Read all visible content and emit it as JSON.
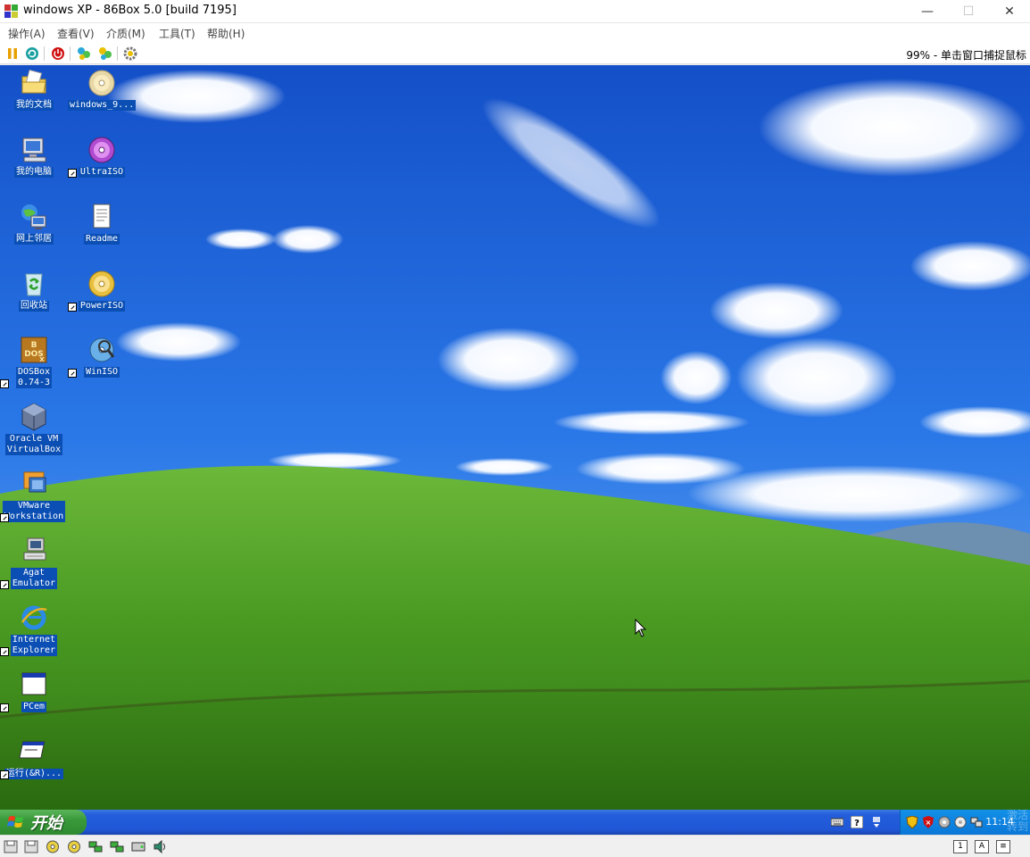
{
  "window": {
    "title": "windows XP - 86Box 5.0 [build 7195]",
    "app_icon": "86box-icon",
    "controls": {
      "minimize": "—",
      "maximize": "☐",
      "close": "✕"
    }
  },
  "menu": [
    "操作(A)",
    "查看(V)",
    "介质(M)",
    "工具(T)",
    "帮助(H)"
  ],
  "toolbar": {
    "buttons": [
      "pause-icon",
      "reset-icon",
      "power-icon",
      "ctrl-alt-del-icon",
      "ctrl-alt-esc-icon",
      "settings-icon"
    ],
    "status": "99% - 单击窗口捕捉鼠标"
  },
  "desktop": {
    "icons": [
      {
        "name": "my-documents",
        "label": "我的文档",
        "icon": "folder-icon",
        "shortcut": false
      },
      {
        "name": "windows-iso",
        "label": "windows_9...",
        "icon": "cd-icon",
        "shortcut": false
      },
      {
        "name": "my-computer",
        "label": "我的电脑",
        "icon": "computer-icon",
        "shortcut": false
      },
      {
        "name": "ultraiso",
        "label": "UltraISO",
        "icon": "disc-icon",
        "shortcut": true
      },
      {
        "name": "network-places",
        "label": "网上邻居",
        "icon": "network-icon",
        "shortcut": false
      },
      {
        "name": "readme",
        "label": "Readme",
        "icon": "document-icon",
        "shortcut": false
      },
      {
        "name": "recycle-bin",
        "label": "回收站",
        "icon": "recycle-bin-icon",
        "shortcut": false
      },
      {
        "name": "poweriso",
        "label": "PowerISO",
        "icon": "cd-icon",
        "shortcut": true
      },
      {
        "name": "dosbox",
        "label": "DOSBox\n0.74-3",
        "icon": "dosbox-icon",
        "shortcut": true
      },
      {
        "name": "winiso",
        "label": "WinISO",
        "icon": "disc-magnifier-icon",
        "shortcut": true
      },
      {
        "name": "virtualbox",
        "label": "Oracle VM\nVirtualBox",
        "icon": "virtualbox-icon",
        "shortcut": true
      },
      {
        "name": "vmware",
        "label": "VMware\nWorkstation",
        "icon": "vmware-icon",
        "shortcut": true
      },
      {
        "name": "agat-emulator",
        "label": "Agat\nEmulator",
        "icon": "retro-computer-icon",
        "shortcut": true
      },
      {
        "name": "internet-explorer",
        "label": "Internet\nExplorer",
        "icon": "ie-icon",
        "shortcut": true
      },
      {
        "name": "pcem",
        "label": "PCem",
        "icon": "window-icon",
        "shortcut": true
      },
      {
        "name": "run",
        "label": "运行(&R)...",
        "icon": "run-icon",
        "shortcut": true
      }
    ]
  },
  "taskbar": {
    "start_label": "开始",
    "clock": "11:14",
    "watermark": "激活\n转到"
  },
  "statusbar": {
    "icons": [
      "floppy-icon",
      "floppy-icon",
      "cdrom-icon",
      "cdrom-icon",
      "network-icon",
      "network-icon",
      "hdd-icon",
      "sound-icon"
    ],
    "right_icons": [
      "1",
      "A",
      "≡"
    ]
  },
  "colors": {
    "sky": "#1f68e0",
    "grass": "#4e9a24",
    "label_bg": "#0b4fb4",
    "taskbar": "#245edb",
    "start": "#3a9a3a"
  }
}
